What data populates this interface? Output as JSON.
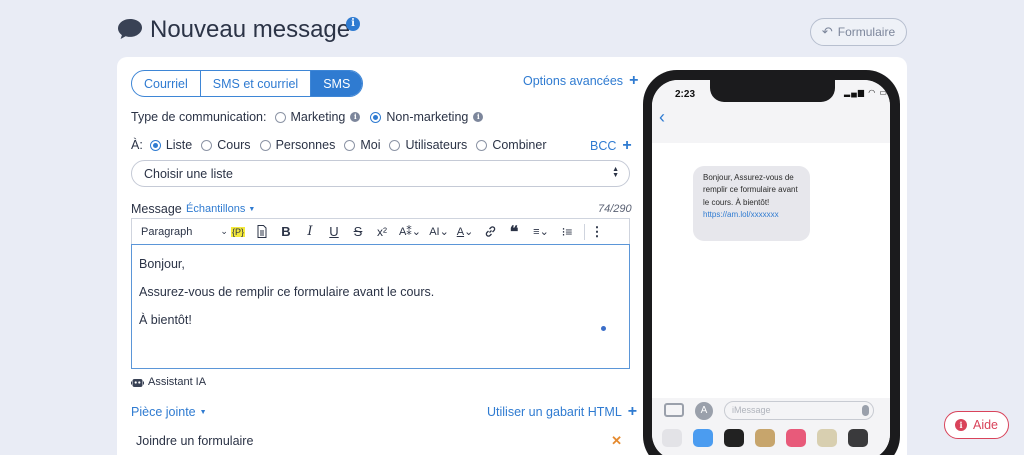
{
  "header": {
    "title": "Nouveau message",
    "info_icon": "info-icon",
    "form_button": "Formulaire"
  },
  "tabs": [
    {
      "label": "Courriel",
      "active": false
    },
    {
      "label": "SMS et courriel",
      "active": false
    },
    {
      "label": "SMS",
      "active": true
    }
  ],
  "advanced_options": "Options avancées",
  "comm_type": {
    "label": "Type de communication:",
    "options": [
      {
        "label": "Marketing",
        "selected": false
      },
      {
        "label": "Non-marketing",
        "selected": true
      }
    ]
  },
  "recipients": {
    "label": "À:",
    "options": [
      {
        "label": "Liste",
        "selected": true
      },
      {
        "label": "Cours",
        "selected": false
      },
      {
        "label": "Personnes",
        "selected": false
      },
      {
        "label": "Moi",
        "selected": false
      },
      {
        "label": "Utilisateurs",
        "selected": false
      },
      {
        "label": "Combiner",
        "selected": false
      }
    ],
    "bcc": "BCC"
  },
  "list_select": {
    "value": "Choisir une liste"
  },
  "message": {
    "label": "Message",
    "samples": "Échantillons",
    "counter": "74/290"
  },
  "toolbar": {
    "paragraph": "Paragraph",
    "placeholder_token": "{P}"
  },
  "editor": {
    "lines": [
      "Bonjour,",
      "Assurez-vous de remplir ce formulaire avant le cours.",
      "À bientôt!"
    ]
  },
  "ai_assistant": "Assistant IA",
  "attachment": {
    "label": "Pièce jointe",
    "html_template": "Utiliser un gabarit HTML",
    "join_form": "Joindre un formulaire"
  },
  "phone": {
    "time": "2:23",
    "bubble_text": "Bonjour, Assurez-vous de remplir ce formulaire avant le cours. À bientôt!",
    "bubble_link": "https://am.lol/xxxxxxx",
    "input_placeholder": "iMessage"
  },
  "help_button": "Aide",
  "colors": {
    "accent": "#2f7bd1",
    "background": "#e9ecf5",
    "help": "#d9435a"
  }
}
